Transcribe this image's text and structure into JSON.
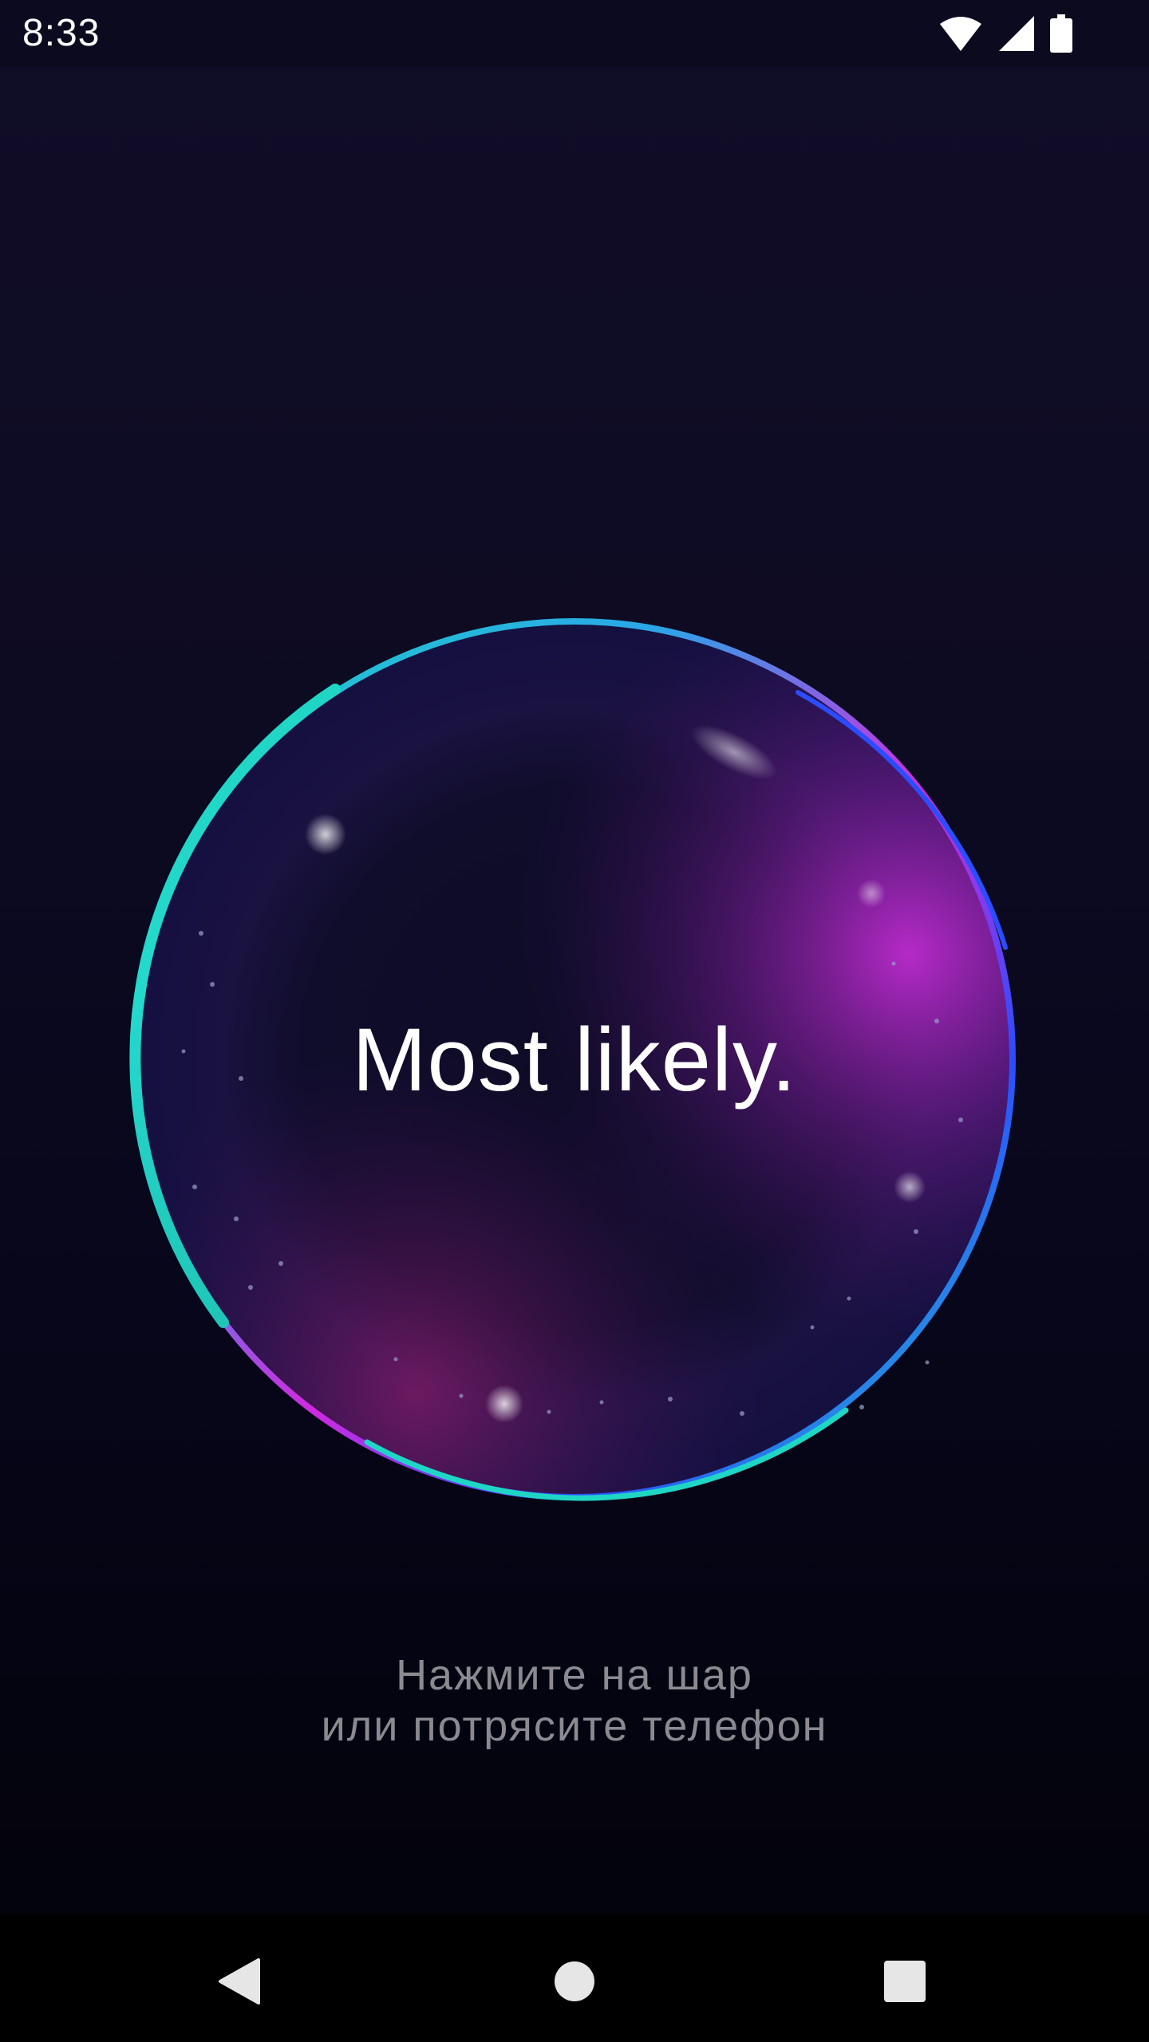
{
  "status_bar": {
    "time": "8:33",
    "icons": [
      "wifi-icon",
      "cell-signal-icon",
      "battery-icon"
    ]
  },
  "orb": {
    "answer": "Most likely.",
    "colors": {
      "rim_teal": "#1fd6c4",
      "rim_blue": "#2a4dff",
      "glow_magenta": "#c42ad0",
      "inner": "#0d0b24"
    }
  },
  "hint": {
    "line1": "Нажмите на шар",
    "line2": "или потрясите телефон"
  },
  "nav": {
    "icons": [
      "back-icon",
      "home-icon",
      "recents-icon"
    ]
  }
}
